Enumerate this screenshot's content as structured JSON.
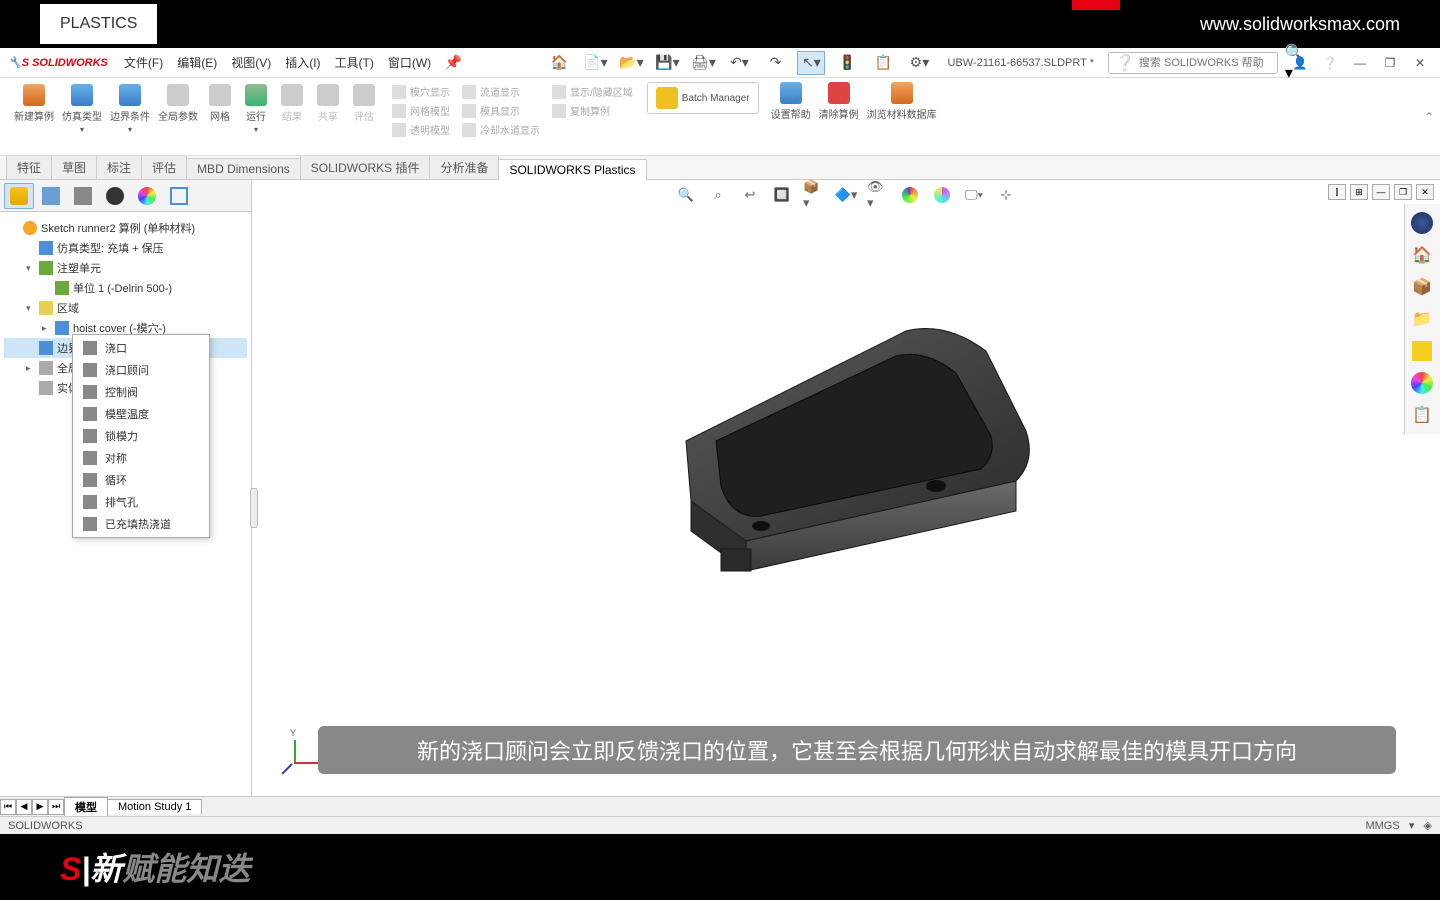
{
  "topbar": {
    "left_partial": "PLASTICS",
    "url": "www.solidworksmax.com"
  },
  "menubar": {
    "logo": "SOLIDWORKS",
    "items": [
      "文件(F)",
      "编辑(E)",
      "视图(V)",
      "插入(I)",
      "工具(T)",
      "窗口(W)"
    ],
    "doc_name": "UBW-21161-66537.SLDPRT *",
    "search_placeholder": "搜索 SOLIDWORKS 帮助"
  },
  "ribbon": {
    "groups": [
      {
        "items": [
          {
            "label": "新建算例"
          },
          {
            "label": "仿真类型"
          },
          {
            "label": "边界条件"
          },
          {
            "label": "全局参数"
          },
          {
            "label": "网格"
          },
          {
            "label": "运行"
          },
          {
            "label": "结果"
          },
          {
            "label": "共享",
            "disabled": true
          },
          {
            "label": "评估",
            "disabled": true
          }
        ]
      },
      {
        "sub": [
          "模穴显示",
          "网格模型",
          "透明模型"
        ]
      },
      {
        "sub": [
          "流道显示",
          "模具显示",
          "冷却水道显示"
        ]
      },
      {
        "sub": [
          "显示/隐藏区域",
          "复制算例"
        ]
      },
      {
        "items": [
          {
            "label": "Batch Manager"
          }
        ]
      },
      {
        "items": [
          {
            "label": "设置帮助"
          },
          {
            "label": "清除算例"
          },
          {
            "label": "浏览材料数据库"
          }
        ]
      }
    ]
  },
  "tabs": [
    "特征",
    "草图",
    "标注",
    "评估",
    "MBD Dimensions",
    "SOLIDWORKS 插件",
    "分析准备",
    "SOLIDWORKS Plastics"
  ],
  "active_tab": "SOLIDWORKS Plastics",
  "tree": [
    {
      "level": 0,
      "exp": "",
      "icon": "orange",
      "label": "Sketch runner2 算例 (单种材料)"
    },
    {
      "level": 1,
      "exp": "",
      "icon": "blue",
      "label": "仿真类型: 充填 + 保压"
    },
    {
      "level": 1,
      "exp": "▾",
      "icon": "green",
      "label": "注塑单元"
    },
    {
      "level": 2,
      "exp": "",
      "icon": "green",
      "label": "单位 1 (-Delrin 500-)"
    },
    {
      "level": 1,
      "exp": "▾",
      "icon": "yellow",
      "label": "区域"
    },
    {
      "level": 2,
      "exp": "▸",
      "icon": "blue",
      "label": "hoist cover (-模穴-)"
    },
    {
      "level": 1,
      "exp": "",
      "icon": "blue",
      "label": "边界条件",
      "selected": true
    },
    {
      "level": 1,
      "exp": "▸",
      "icon": "gray",
      "label": "全局参"
    },
    {
      "level": 1,
      "exp": "",
      "icon": "gray",
      "label": "实体网"
    }
  ],
  "context_menu": [
    "浇口",
    "浇口顾问",
    "控制阀",
    "模壁温度",
    "锁模力",
    "对称",
    "循环",
    "排气孔",
    "已充填热浇道"
  ],
  "triad": {
    "y": "Y"
  },
  "subtitle": "新的浇口顾问会立即反馈浇口的位置，它甚至会根据几何形状自动求解最佳的模具开口方向",
  "bottom_tabs": [
    "模型",
    "Motion Study 1"
  ],
  "status": {
    "left": "SOLIDWORKS",
    "right": "MMGS"
  },
  "bottom_logo": {
    "prefix": "S",
    "text": "新"
  }
}
